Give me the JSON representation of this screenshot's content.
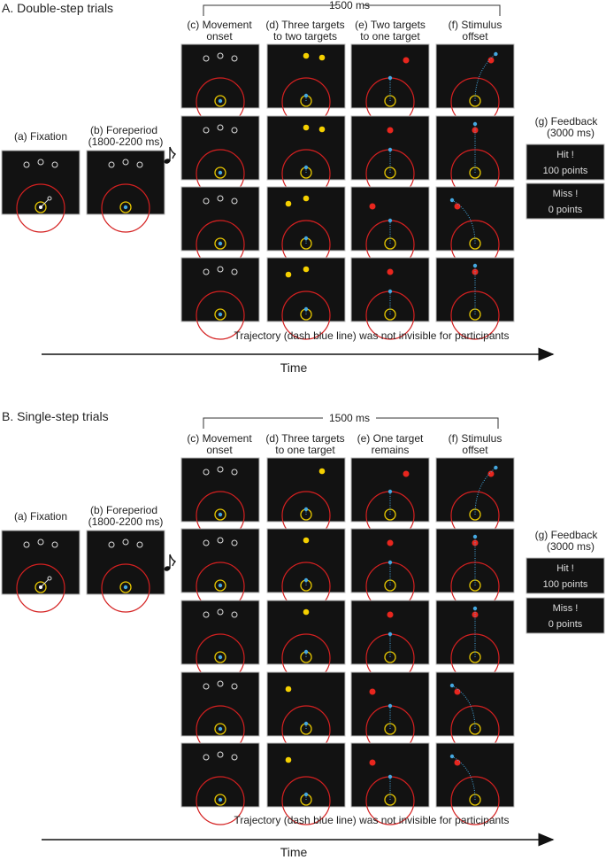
{
  "colors": {
    "panel": "#121212",
    "panel_border": "#bbbbbb",
    "boundary": "#d42020",
    "start": "#e8c800",
    "cursor": "#45a8e0",
    "target_open": "#dddddd",
    "target_cued": "#f5d000",
    "target_final": "#e8261e"
  },
  "section_a": {
    "title": "A. Double-step trials",
    "duration": "1500 ms",
    "labels": {
      "a": "(a) Fixation",
      "b1": "(b) Foreperiod",
      "b2": "(1800-2200 ms)",
      "c1": "(c) Movement",
      "c2": "onset",
      "d1": "(d) Three targets",
      "d2": "to two targets",
      "e1": "(e) Two targets",
      "e2": "to one target",
      "f1": "(f) Stimulus",
      "f2": "offset",
      "g1": "(g) Feedback",
      "g2": "(3000 ms)"
    },
    "rows": [
      {
        "cued": [
          "center",
          "right"
        ],
        "final": "right"
      },
      {
        "cued": [
          "center",
          "right"
        ],
        "final": "center"
      },
      {
        "cued": [
          "left",
          "center"
        ],
        "final": "left"
      },
      {
        "cued": [
          "left",
          "center"
        ],
        "final": "center"
      }
    ],
    "feedback": [
      {
        "result": "Hit !",
        "points": "100 points"
      },
      {
        "result": "Miss !",
        "points": "0 points"
      }
    ],
    "note": "Trajectory (dash blue line) was not invisible for participants",
    "axis": "Time"
  },
  "section_b": {
    "title": "B. Single-step trials",
    "duration": "1500 ms",
    "labels": {
      "a": "(a) Fixation",
      "b1": "(b) Foreperiod",
      "b2": "(1800-2200 ms)",
      "c1": "(c) Movement",
      "c2": "onset",
      "d1": "(d) Three targets",
      "d2": "to one target",
      "e1": "(e) One target",
      "e2": "remains",
      "f1": "(f) Stimulus",
      "f2": "offset",
      "g1": "(g) Feedback",
      "g2": "(3000 ms)"
    },
    "rows": [
      {
        "cued": [
          "right"
        ],
        "final": "right"
      },
      {
        "cued": [
          "center"
        ],
        "final": "center"
      },
      {
        "cued": [
          "center"
        ],
        "final": "center"
      },
      {
        "cued": [
          "left"
        ],
        "final": "left"
      },
      {
        "cued": [
          "left"
        ],
        "final": "left"
      }
    ],
    "feedback": [
      {
        "result": "Hit !",
        "points": "100 points"
      },
      {
        "result": "Miss !",
        "points": "0 points"
      }
    ],
    "note": "Trajectory (dash blue line) was not invisible for participants",
    "axis": "Time"
  }
}
